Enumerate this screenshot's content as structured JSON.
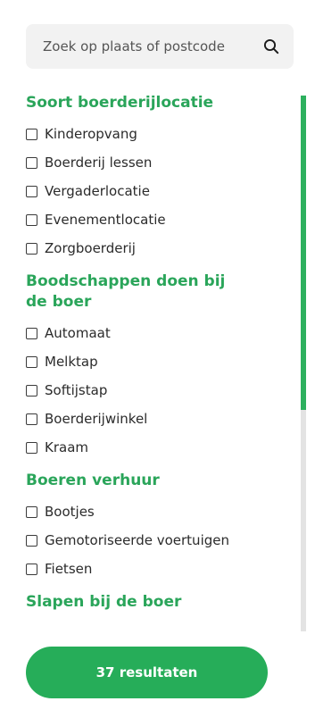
{
  "search": {
    "placeholder": "Zoek op plaats of postcode",
    "icon": "search-icon"
  },
  "filters": {
    "groups": [
      {
        "title": "Soort boerderijlocatie",
        "options": [
          "Kinderopvang",
          "Boerderij lessen",
          "Vergaderlocatie",
          "Evenementlocatie",
          "Zorgboerderij"
        ]
      },
      {
        "title": "Boodschappen doen bij de boer",
        "options": [
          "Automaat",
          "Melktap",
          "Softijstap",
          "Boerderijwinkel",
          "Kraam"
        ]
      },
      {
        "title": "Boeren verhuur",
        "options": [
          "Bootjes",
          "Gemotoriseerde voertuigen",
          "Fietsen"
        ]
      },
      {
        "title": "Slapen bij de boer",
        "options": []
      }
    ]
  },
  "results_button": {
    "label": "37 resultaten"
  },
  "colors": {
    "accent": "#2aa55a",
    "button": "#26ad59",
    "scroll_thumb": "#2db05e",
    "search_bg": "#f2f2f2"
  },
  "scroll": {
    "position_fraction": 0
  }
}
